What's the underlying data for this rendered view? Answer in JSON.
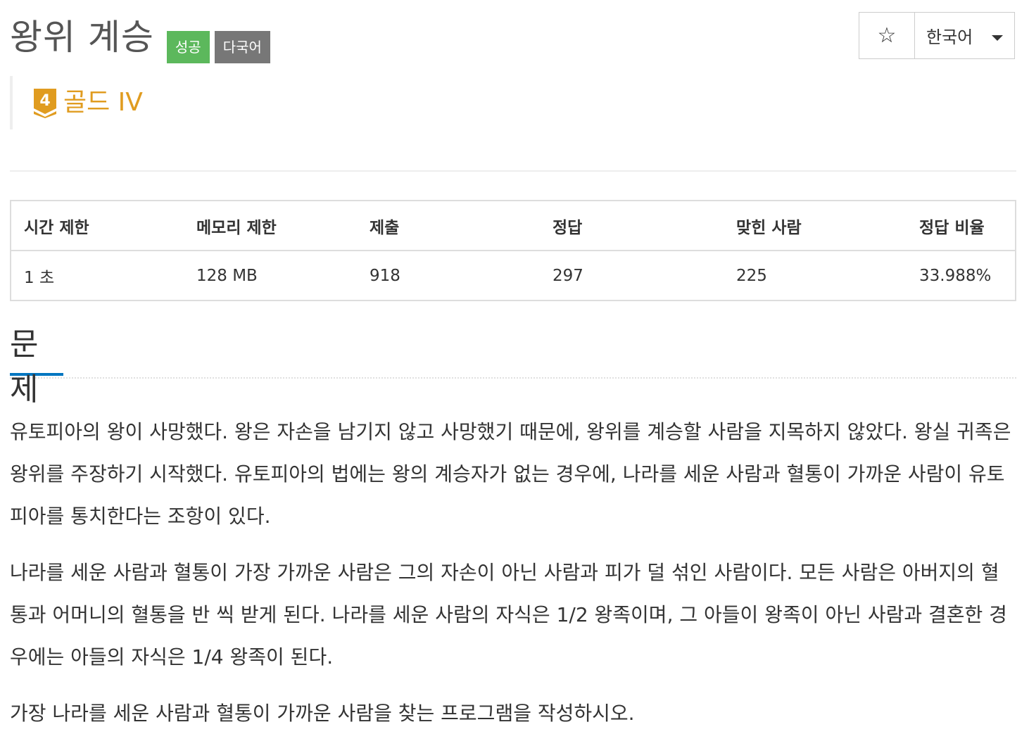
{
  "header": {
    "title": "왕위 계승",
    "badge_success": "성공",
    "badge_language": "다국어",
    "star_icon": "☆",
    "language_selected": "한국어"
  },
  "tier": {
    "level": "4",
    "label": "골드 IV",
    "color": "#e09c20"
  },
  "stats": {
    "headers": [
      "시간 제한",
      "메모리 제한",
      "제출",
      "정답",
      "맞힌 사람",
      "정답 비율"
    ],
    "values": [
      "1 초",
      "128 MB",
      "918",
      "297",
      "225",
      "33.988%"
    ]
  },
  "problem": {
    "heading": "문제",
    "paragraphs": [
      "유토피아의 왕이 사망했다. 왕은 자손을 남기지 않고 사망했기 때문에, 왕위를 계승할 사람을 지목하지 않았다. 왕실 귀족은 왕위를 주장하기 시작했다. 유토피아의 법에는 왕의 계승자가 없는 경우에, 나라를 세운 사람과 혈통이 가까운 사람이 유토피아를 통치한다는 조항이 있다.",
      "나라를 세운 사람과 혈통이 가장 가까운 사람은 그의 자손이 아닌 사람과 피가 덜 섞인 사람이다. 모든 사람은 아버지의 혈통과 어머니의 혈통을 반 씩 받게 된다. 나라를 세운 사람의 자식은 1/2 왕족이며, 그 아들이 왕족이 아닌 사람과 결혼한 경우에는 아들의 자식은 1/4 왕족이 된다.",
      "가장 나라를 세운 사람과 혈통이 가까운 사람을 찾는 프로그램을 작성하시오."
    ]
  },
  "colors": {
    "success": "#5cb85c",
    "language_badge": "#777777",
    "section_underline": "#0076c0"
  }
}
